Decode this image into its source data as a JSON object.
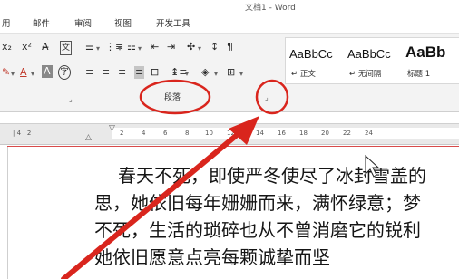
{
  "window": {
    "title": "文档1 - Word"
  },
  "tabs": [
    "用",
    "邮件",
    "审阅",
    "视图",
    "开发工具"
  ],
  "ribbon": {
    "group_label": "段落",
    "styles": [
      {
        "sample": "AaBbCc",
        "name": "↵ 正文"
      },
      {
        "sample": "AaBbCc",
        "name": "↵ 无间隔"
      },
      {
        "sample": "AaBb",
        "name": "标题 1"
      }
    ]
  },
  "ruler": {
    "ticks": [
      "2",
      "4",
      "6",
      "8",
      "10",
      "12",
      "14",
      "16",
      "18",
      "20",
      "22",
      "24"
    ]
  },
  "document": {
    "lines": [
      "春天不死，即使严冬使尽了冰封雪盖的",
      "思，她依旧每年姗姗而来，满怀绿意；梦",
      "不死，生活的琐碎也从不曾消磨它的锐利",
      "她依旧愿意点亮每颗诚挚而坚"
    ]
  },
  "annotation": {
    "color": "#d9251d"
  }
}
